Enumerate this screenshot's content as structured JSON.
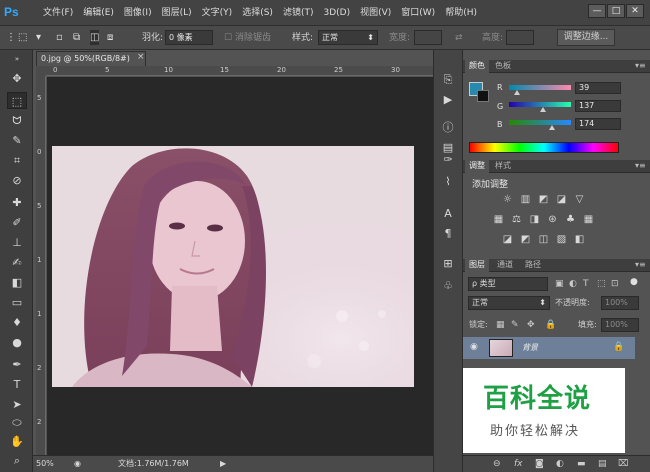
{
  "app": {
    "logo": "Ps"
  },
  "menu": [
    "文件(F)",
    "编辑(E)",
    "图像(I)",
    "图层(L)",
    "文字(Y)",
    "选择(S)",
    "滤镜(T)",
    "3D(D)",
    "视图(V)",
    "窗口(W)",
    "帮助(H)"
  ],
  "window_buttons": {
    "minimize": "—",
    "maximize": "□",
    "close": "✕"
  },
  "options": {
    "feather_label": "羽化:",
    "feather_value": "0 像素",
    "antialias_label": "消除锯齿",
    "style_label": "样式:",
    "style_value": "正常",
    "width_label": "宽度:",
    "height_label": "高度:",
    "refine_button": "调整边缘..."
  },
  "document": {
    "tab_title": "0.jpg @ 50%(RGB/8#)",
    "tab_close": "×",
    "ruler_top": [
      "0",
      "5",
      "10",
      "15",
      "20",
      "25",
      "30"
    ],
    "ruler_left": [
      "5",
      "0",
      "5",
      "1",
      "1",
      "2",
      "2"
    ]
  },
  "status": {
    "zoom": "50%",
    "doc_info": "文档:1.76M/1.76M"
  },
  "color_panel": {
    "tabs": [
      "颜色",
      "色板"
    ],
    "r_label": "R",
    "g_label": "G",
    "b_label": "B",
    "r_value": "39",
    "g_value": "137",
    "b_value": "174",
    "swatch_color": "#2789ae"
  },
  "adjust_panel": {
    "tabs": [
      "调整",
      "样式"
    ],
    "heading": "添加调整"
  },
  "layers_panel": {
    "tabs": [
      "图层",
      "通道",
      "路径"
    ],
    "filter_placeholder": "ρ 类型",
    "blend_mode": "正常",
    "opacity_label": "不透明度:",
    "opacity_value": "100%",
    "lock_label": "锁定:",
    "fill_label": "填充:",
    "fill_value": "100%",
    "layer_name": "背景"
  },
  "watermark": {
    "title": "百科全说",
    "subtitle": "助你轻松解决"
  }
}
